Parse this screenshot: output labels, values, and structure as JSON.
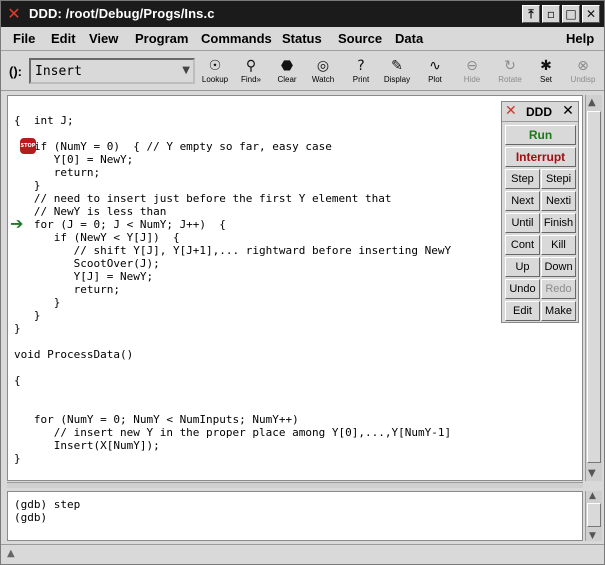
{
  "window": {
    "title": "DDD: /root/Debug/Progs/Ins.c",
    "app_icon": "x-logo-icon",
    "controls": [
      "pin-icon",
      "restore-icon",
      "maximize-icon",
      "close-icon"
    ]
  },
  "menubar": {
    "items": [
      "File",
      "Edit",
      "View",
      "Program",
      "Commands",
      "Status",
      "Source",
      "Data"
    ],
    "help": "Help"
  },
  "toolbar": {
    "arg_label": "():",
    "arg_value": "Insert",
    "tools": [
      {
        "label": "Lookup",
        "icon": "lookup-icon",
        "enabled": true
      },
      {
        "label": "Find»",
        "icon": "binoculars-icon",
        "enabled": true
      },
      {
        "label": "Clear",
        "icon": "stop-icon",
        "enabled": true
      },
      {
        "label": "Watch",
        "icon": "watch-icon",
        "enabled": true
      },
      {
        "label": "Print",
        "icon": "print-icon",
        "enabled": true
      },
      {
        "label": "Display",
        "icon": "display-icon",
        "enabled": true
      },
      {
        "label": "Plot",
        "icon": "plot-icon",
        "enabled": true
      },
      {
        "label": "Hide",
        "icon": "hide-icon",
        "enabled": false
      },
      {
        "label": "Rotate",
        "icon": "rotate-icon",
        "enabled": false
      },
      {
        "label": "Set",
        "icon": "set-icon",
        "enabled": true
      },
      {
        "label": "Undisp",
        "icon": "undisp-icon",
        "enabled": false
      }
    ]
  },
  "source": {
    "lines": [
      "{  int J;",
      "",
      "   if (NumY = 0)  { // Y empty so far, easy case",
      "      Y[0] = NewY;",
      "      return;",
      "   }",
      "   // need to insert just before the first Y element that",
      "   // NewY is less than",
      "   for (J = 0; J < NumY; J++)  {",
      "      if (NewY < Y[J])  {",
      "         // shift Y[J], Y[J+1],... rightward before inserting NewY",
      "         ScootOver(J);",
      "         Y[J] = NewY;",
      "         return;",
      "      }",
      "   }",
      "}",
      "",
      "void ProcessData()",
      "",
      "{",
      "",
      "",
      "   for (NumY = 0; NumY < NumInputs; NumY++)",
      "      // insert new Y in the proper place among Y[0],...,Y[NumY-1]",
      "      Insert(X[NumY]);",
      "}"
    ],
    "breakpoint_line": 2,
    "breakpoint_label": "STOP",
    "exec_line": 8
  },
  "console": {
    "lines": [
      "(gdb) step",
      "(gdb)"
    ]
  },
  "command_tool": {
    "title": "DDD",
    "run": "Run",
    "interrupt": "Interrupt",
    "run_color": "#1a7a1a",
    "interrupt_color": "#a01212",
    "buttons": [
      [
        "Step",
        "Stepi"
      ],
      [
        "Next",
        "Nexti"
      ],
      [
        "Until",
        "Finish"
      ],
      [
        "Cont",
        "Kill"
      ],
      [
        "Up",
        "Down"
      ],
      [
        "Undo",
        "Redo"
      ],
      [
        "Edit",
        "Make"
      ]
    ],
    "disabled": [
      "Redo"
    ]
  }
}
